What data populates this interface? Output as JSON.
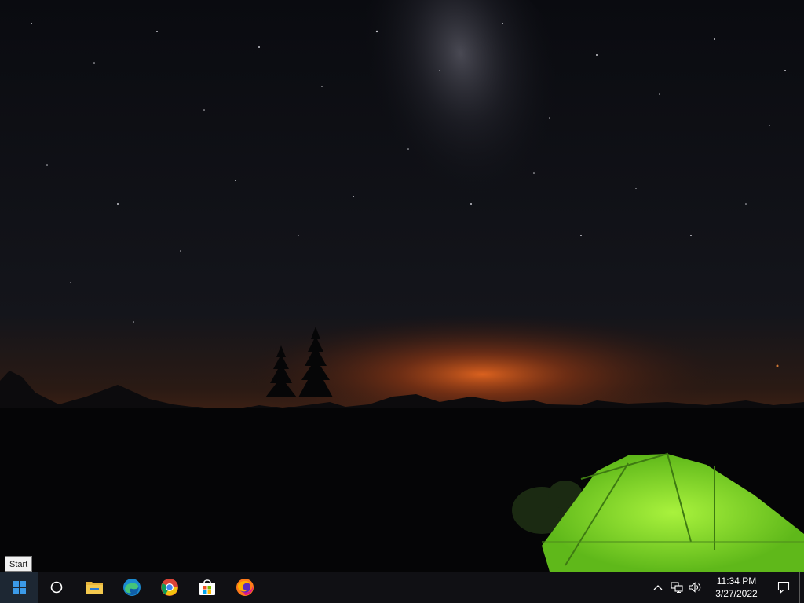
{
  "tooltip": {
    "text": "Start"
  },
  "taskbar": {
    "start_label": "Start",
    "pinned": [
      {
        "icon": "search-circle-icon"
      },
      {
        "icon": "file-explorer-icon"
      },
      {
        "icon": "edge-icon"
      },
      {
        "icon": "chrome-icon"
      },
      {
        "icon": "microsoft-store-icon"
      },
      {
        "icon": "firefox-icon"
      }
    ]
  },
  "tray": {
    "time": "11:34 PM",
    "date": "3/27/2022",
    "icons": [
      "chevron-up-icon",
      "network-icon",
      "volume-icon",
      "notification-icon"
    ]
  },
  "colors": {
    "taskbar": "#101014",
    "sky": "#0b0d12",
    "glow": "#d2561e",
    "tent": "#7ddc2c"
  }
}
